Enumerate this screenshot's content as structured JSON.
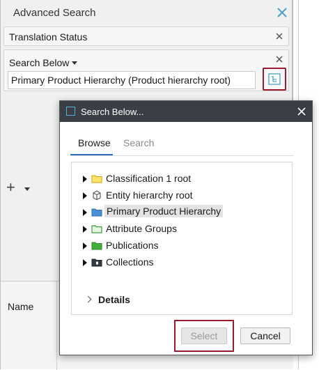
{
  "panel": {
    "title": "Advanced Search",
    "translation_status_label": "Translation Status",
    "search_below_label": "Search Below",
    "search_below_value": "Primary Product Hierarchy (Product hierarchy root)",
    "add_label": "+",
    "results_column": "Name"
  },
  "dialog": {
    "title": "Search Below...",
    "tabs": [
      {
        "label": "Browse",
        "active": true
      },
      {
        "label": "Search",
        "active": false
      }
    ],
    "tree": [
      {
        "label": "Classification 1 root",
        "icon": "yellow-folder-icon"
      },
      {
        "label": "Entity hierarchy root",
        "icon": "cube-icon"
      },
      {
        "label": "Primary Product Hierarchy",
        "icon": "blue-folder-icon",
        "selected": true
      },
      {
        "label": "Attribute Groups",
        "icon": "green-outline-folder-icon"
      },
      {
        "label": "Publications",
        "icon": "green-folder-icon"
      },
      {
        "label": "Collections",
        "icon": "collection-icon"
      }
    ],
    "details_label": "Details",
    "select_label": "Select",
    "cancel_label": "Cancel"
  },
  "colors": {
    "accent_tab": "#2d6db5",
    "highlight_outline": "#9b1b2e",
    "titlebar": "#3b3f45"
  }
}
